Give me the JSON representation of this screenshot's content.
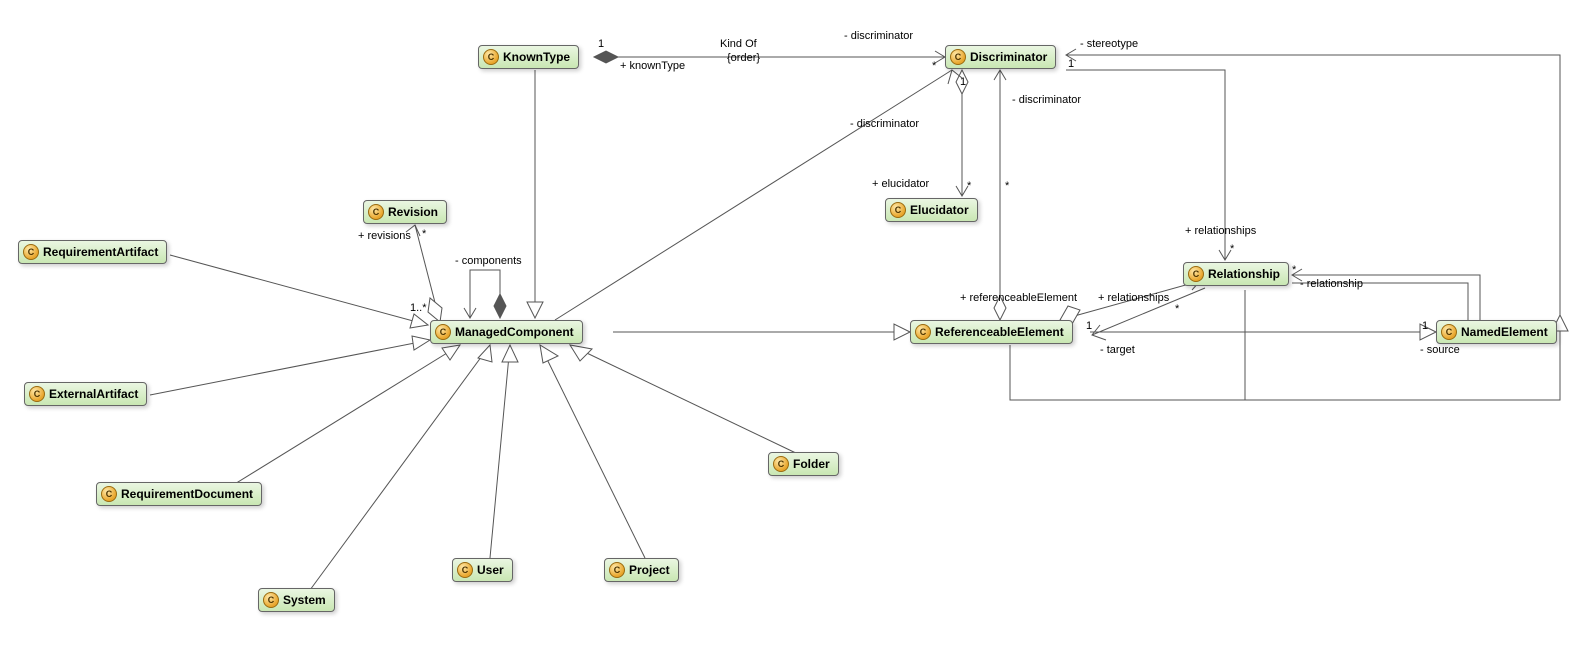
{
  "classes": {
    "KnownType": "KnownType",
    "Discriminator": "Discriminator",
    "Revision": "Revision",
    "Elucidator": "Elucidator",
    "RequirementArtifact": "RequirementArtifact",
    "Relationship": "Relationship",
    "ManagedComponent": "ManagedComponent",
    "ReferenceableElement": "ReferenceableElement",
    "NamedElement": "NamedElement",
    "ExternalArtifact": "ExternalArtifact",
    "Folder": "Folder",
    "RequirementDocument": "RequirementDocument",
    "User": "User",
    "Project": "Project",
    "System": "System"
  },
  "labels": {
    "kindOf": "Kind Of",
    "order": "{order}",
    "one_kt": "1",
    "knownType": "+ knownType",
    "discr_role1": "- discriminator",
    "star_kt": "*",
    "stereotype": "- stereotype",
    "one_disc_sr": "1",
    "one_disc_left": "1",
    "discr_role2": "- discriminator",
    "discr_role3": "- discriminator",
    "star_el1": "*",
    "star_el2": "*",
    "elucidator": "+ elucidator",
    "revisions": "+ revisions",
    "star_rev": "*",
    "one_many": "1..*",
    "components": "- components",
    "relationships1": "+ relationships",
    "star_rel1": "*",
    "refElement": "+ referenceableElement",
    "relationships2": "+ relationships",
    "star_rel2": "*",
    "one_ref": "1",
    "target": "- target",
    "relationship_role": "- relationship",
    "star_rel_ne": "*",
    "one_ne": "1",
    "source": "- source"
  }
}
